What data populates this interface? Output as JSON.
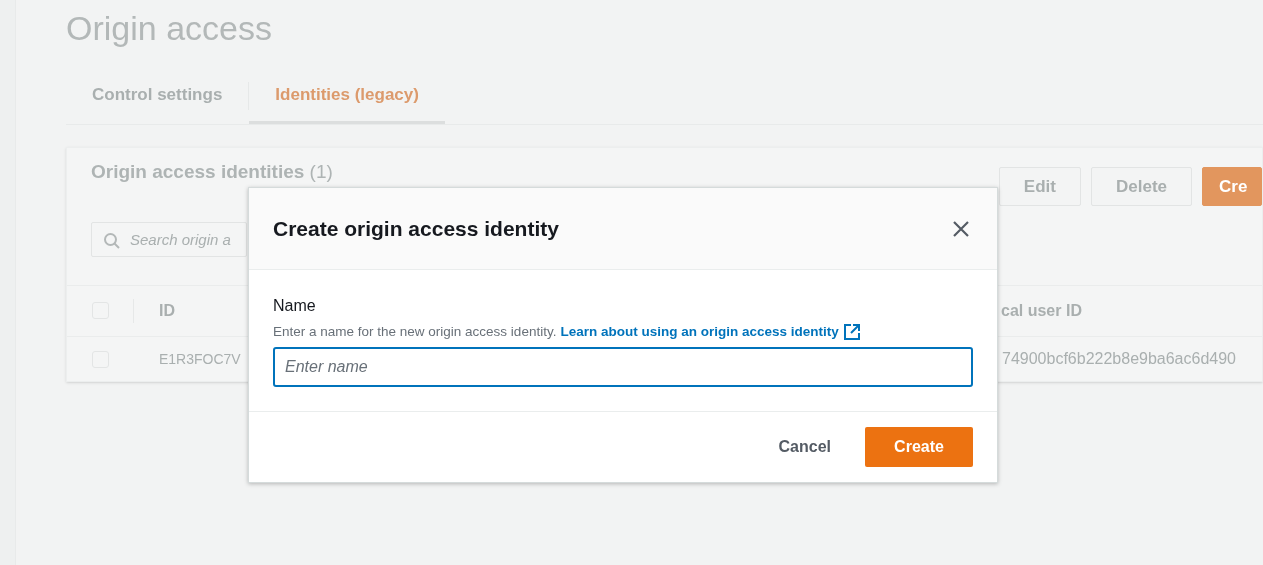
{
  "page": {
    "title": "Origin access"
  },
  "tabs": [
    {
      "label": "Control settings",
      "selected": false
    },
    {
      "label": "Identities (legacy)",
      "selected": true
    }
  ],
  "panel": {
    "title": "Origin access identities",
    "count": "(1)",
    "buttons": [
      {
        "label": "Edit",
        "kind": "normal"
      },
      {
        "label": "Delete",
        "kind": "normal"
      },
      {
        "label": "Cre",
        "kind": "primary"
      }
    ],
    "search": {
      "placeholder": "Search origin a"
    },
    "select_all": {
      "checked": false
    },
    "columns": [
      "ID",
      "cal user ID"
    ],
    "rows": [
      {
        "checked": false,
        "cells": [
          "E1R3FOC7V",
          "74900bcf6b222b8e9ba6ac6d490"
        ]
      }
    ]
  },
  "modal": {
    "title": "Create origin access identity",
    "field": {
      "label": "Name",
      "description": "Enter a name for the new origin access identity.",
      "link": "Learn about using an origin access identity",
      "placeholder": "Enter name"
    },
    "buttons": [
      {
        "label": "Cancel",
        "kind": "link"
      },
      {
        "label": "Create",
        "kind": "primary"
      }
    ]
  }
}
